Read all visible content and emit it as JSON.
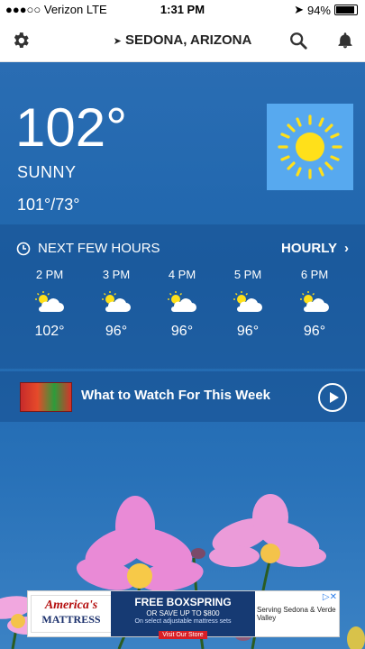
{
  "status_bar": {
    "carrier": "●●●○○ Verizon  LTE",
    "time": "1:31 PM",
    "battery": "94%"
  },
  "header": {
    "location": "SEDONA, ARIZONA"
  },
  "current": {
    "temperature": "102°",
    "condition": "SUNNY",
    "hi_lo": "101°/73°"
  },
  "next_hours": {
    "title": "NEXT FEW HOURS",
    "hourly_link": "HOURLY",
    "items": [
      {
        "time": "2 PM",
        "temp": "102°"
      },
      {
        "time": "3 PM",
        "temp": "96°"
      },
      {
        "time": "4 PM",
        "temp": "96°"
      },
      {
        "time": "5 PM",
        "temp": "96°"
      },
      {
        "time": "6 PM",
        "temp": "96°"
      }
    ]
  },
  "video": {
    "title": "What to Watch For This Week"
  },
  "ad": {
    "brand_line1": "America's",
    "brand_line2": "MATTRESS",
    "headline": "FREE BOXSPRING",
    "subhead": "OR SAVE UP TO $800",
    "fineprint": "On select adjustable mattress sets",
    "cta": "Visit Our Store",
    "serving": "Serving Sedona & Verde Valley"
  },
  "colors": {
    "sky": "#1f66ad",
    "sunbox": "#57a9ef",
    "sun": "#ffe01a"
  }
}
